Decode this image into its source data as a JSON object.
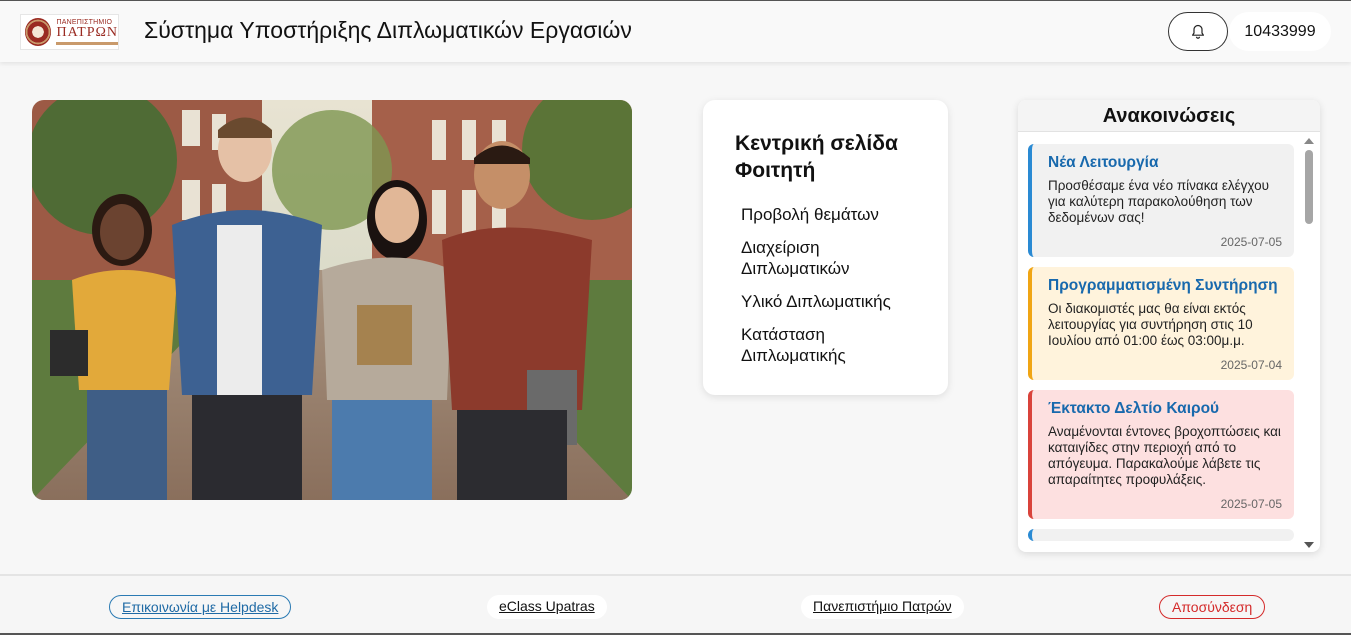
{
  "header": {
    "logo": {
      "line1": "ΠΑΝΕΠΙΣΤΗΜΙΟ",
      "line2": "ΠΑΤΡΩΝ",
      "line3": "UNIVERSITY OF PATRAS"
    },
    "title": "Σύστημα Υποστήριξης Διπλωματικών Εργασιών",
    "notifications_icon": "bell-icon",
    "user_id": "10433999"
  },
  "hero": {
    "image_icon": "students-photo"
  },
  "student_menu": {
    "title": "Κεντρική σελίδα Φοιτητή",
    "items": [
      "Προβολή θεμάτων",
      "Διαχείριση Διπλωματικών",
      "Υλικό Διπλωματικής",
      "Κατάσταση Διπλωματικής"
    ]
  },
  "announcements": {
    "title": "Ανακοινώσεις",
    "items": [
      {
        "title": "Νέα Λειτουργία",
        "body": "Προσθέσαμε ένα νέο πίνακα ελέγχου για καλύτερη παρακολούθηση των δεδομένων σας!",
        "date": "2025-07-05",
        "color": "#2a8ad3"
      },
      {
        "title": "Προγραμματισμένη Συντήρηση",
        "body": "Οι διακομιστές μας θα είναι εκτός λειτουργίας για συντήρηση στις 10 Ιουλίου από 01:00 έως 03:00μ.μ.",
        "date": "2025-07-04",
        "color": "#f0a514"
      },
      {
        "title": "Έκτακτο Δελτίο Καιρού",
        "body": "Αναμένονται έντονες βροχοπτώσεις και καταιγίδες στην περιοχή από το απόγευμα. Παρακαλούμε λάβετε τις απαραίτητες προφυλάξεις.",
        "date": "2025-07-05",
        "color": "#d9433b"
      }
    ]
  },
  "footer": {
    "helpdesk": "Επικοινωνία με Helpdesk",
    "eclass": "eClass Upatras",
    "university": "Πανεπιστήμιο Πατρών",
    "logout": "Αποσύνδεση"
  },
  "colors": {
    "link_blue": "#1f6aa5",
    "logout_red": "#d42a2a",
    "brand": "#9a2b22"
  }
}
